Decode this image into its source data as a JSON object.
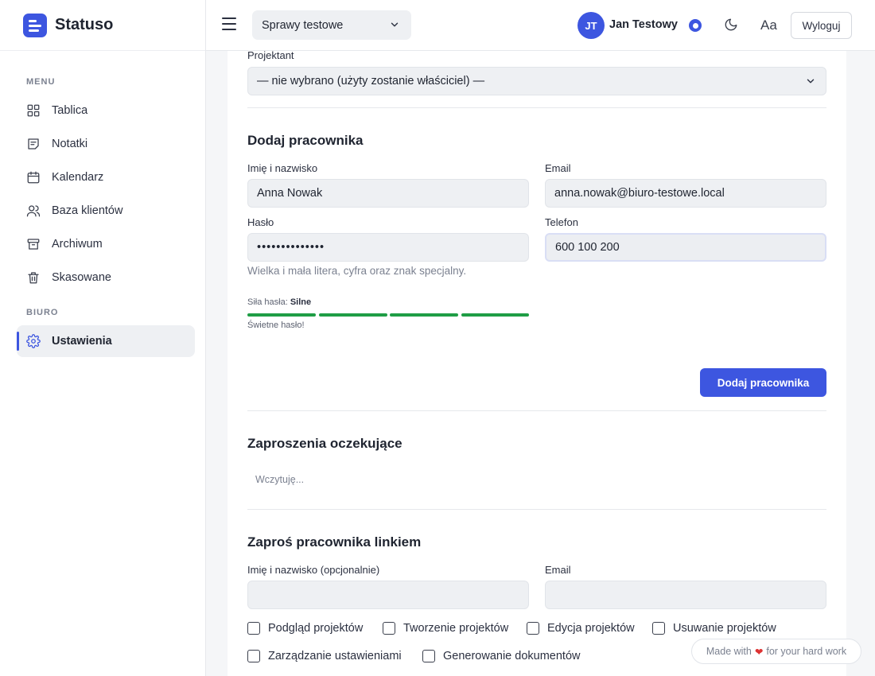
{
  "brand": {
    "name": "Statuso"
  },
  "sidebar": {
    "section_menu": "MENU",
    "items": [
      {
        "label": "Tablica",
        "icon": "grid-icon"
      },
      {
        "label": "Notatki",
        "icon": "note-icon"
      },
      {
        "label": "Kalendarz",
        "icon": "calendar-icon"
      },
      {
        "label": "Baza klientów",
        "icon": "users-icon"
      },
      {
        "label": "Archiwum",
        "icon": "archive-icon"
      },
      {
        "label": "Skasowane",
        "icon": "trash-icon"
      }
    ],
    "section_office": "BIURO",
    "office_items": [
      {
        "label": "Ustawienia",
        "icon": "gear-icon",
        "active": true
      }
    ]
  },
  "topbar": {
    "case_select": "Sprawy testowe",
    "avatar_initials": "JT",
    "user_name": "Jan Testowy",
    "font_toggle": "Aa",
    "logout": "Wyloguj"
  },
  "projektant": {
    "label": "Projektant",
    "value": "— nie wybrano (użyty zostanie właściciel) —"
  },
  "add_employee": {
    "title": "Dodaj pracownika",
    "name_label": "Imię i nazwisko",
    "name_value": "Anna Nowak",
    "email_label": "Email",
    "email_value": "anna.nowak@biuro-testowe.local",
    "password_label": "Hasło",
    "password_value": "••••••••••••••",
    "phone_label": "Telefon",
    "phone_value": "600 100 200",
    "password_hint": "Wielka i mała litera, cyfra oraz znak specjalny.",
    "strength_label": "Siła hasła:",
    "strength_value": "Silne",
    "strength_level": 1.0,
    "strength_message": "Świetne hasło!",
    "submit": "Dodaj pracownika"
  },
  "pending": {
    "title": "Zaproszenia oczekujące",
    "loading": "Wczytuję..."
  },
  "invite": {
    "title": "Zaproś pracownika linkiem",
    "name_label": "Imię i nazwisko (opcjonalnie)",
    "email_label": "Email",
    "permissions": [
      "Podgląd projektów",
      "Tworzenie projektów",
      "Edycja projektów",
      "Usuwanie projektów",
      "Zarządzanie ustawieniami",
      "Generowanie dokumentów"
    ]
  },
  "footer": {
    "made_prefix": "Made with",
    "made_suffix": "for your hard work"
  },
  "colors": {
    "accent": "#3d56e0",
    "strength": "#1f9d45"
  }
}
